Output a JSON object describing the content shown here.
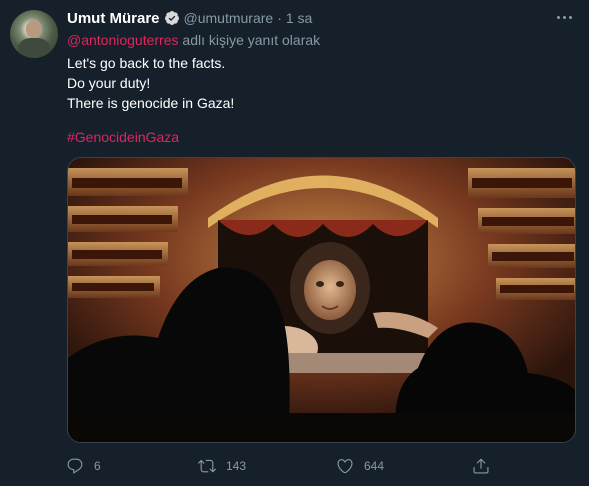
{
  "tweet": {
    "display_name": "Umut Mürare",
    "handle": "@umutmurare",
    "separator": "·",
    "time": "1 sa",
    "reply_to": {
      "mention": "@antonioguterres",
      "suffix": "adlı kişiye yanıt olarak"
    },
    "lines": [
      "Let's go back to the facts.",
      "Do your duty!",
      "There is genocide in Gaza!"
    ],
    "hashtag": "#GenocideinGaza",
    "image": {
      "subject": "theatre-audience-watching-crying-child-photo"
    },
    "actions": {
      "reply_count": "6",
      "retweet_count": "143",
      "like_count": "644"
    }
  },
  "colors": {
    "background": "#15202b",
    "secondary_text": "#8899a6",
    "accent": "#e0245e",
    "verified": "#1da1f2"
  },
  "icons": [
    "avatar",
    "verified-badge-icon",
    "more-icon",
    "reply-icon",
    "retweet-icon",
    "like-icon",
    "share-icon"
  ]
}
